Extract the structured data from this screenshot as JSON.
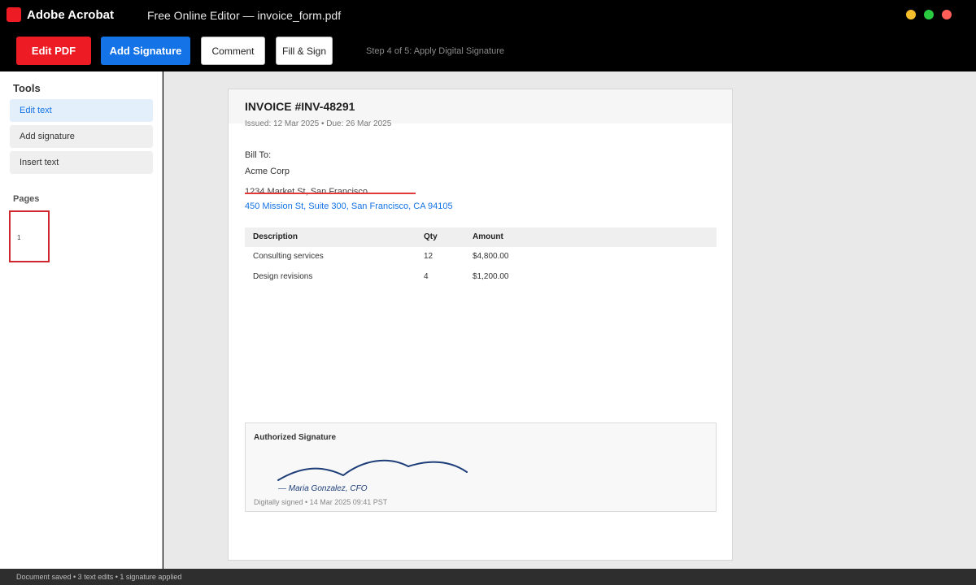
{
  "app": {
    "name": "Adobe Acrobat",
    "window_title": "Free Online Editor — invoice_form.pdf"
  },
  "toolbar": {
    "edit_pdf_label": "Edit PDF",
    "add_signature_label": "Add Signature",
    "comment_label": "Comment",
    "fill_sign_label": "Fill & Sign",
    "step_text": "Step 4 of 5: Apply Digital Signature"
  },
  "sidebar": {
    "tools_heading": "Tools",
    "tools": [
      {
        "label": "Edit text",
        "active": true
      },
      {
        "label": "Add signature",
        "active": false
      },
      {
        "label": "Insert text",
        "active": false
      }
    ],
    "pages_heading": "Pages",
    "pages": [
      {
        "number": "1"
      }
    ]
  },
  "document": {
    "invoice_title": "INVOICE #INV-48291",
    "dates": "Issued: 12 Mar 2025 • Due: 26 Mar 2025",
    "bill_to_label": "Bill To:",
    "company": "Acme Corp",
    "old_address": "1234 Market St, San Francisco",
    "new_address": "450 Mission St, Suite 300, San Francisco, CA 94105",
    "table": {
      "headers": [
        "Description",
        "Qty",
        "Amount"
      ],
      "rows": [
        [
          "Consulting services",
          "12",
          "$4,800.00"
        ],
        [
          "Design revisions",
          "4",
          "$1,200.00"
        ]
      ]
    },
    "signature": {
      "title": "Authorized Signature",
      "signer": "— Maria Gonzalez, CFO",
      "meta": "Digitally signed • 14 Mar 2025 09:41 PST"
    }
  },
  "status": {
    "text": "Document saved • 3 text edits • 1 signature applied"
  },
  "colors": {
    "brand_red": "#ed1c24",
    "primary_blue": "#1473e6",
    "strike_red": "#e03a3a",
    "signature_ink": "#1c3d78"
  },
  "icons": [
    "acrobat-logo-icon",
    "minimize-dot-icon",
    "maximize-dot-icon",
    "close-dot-icon"
  ]
}
